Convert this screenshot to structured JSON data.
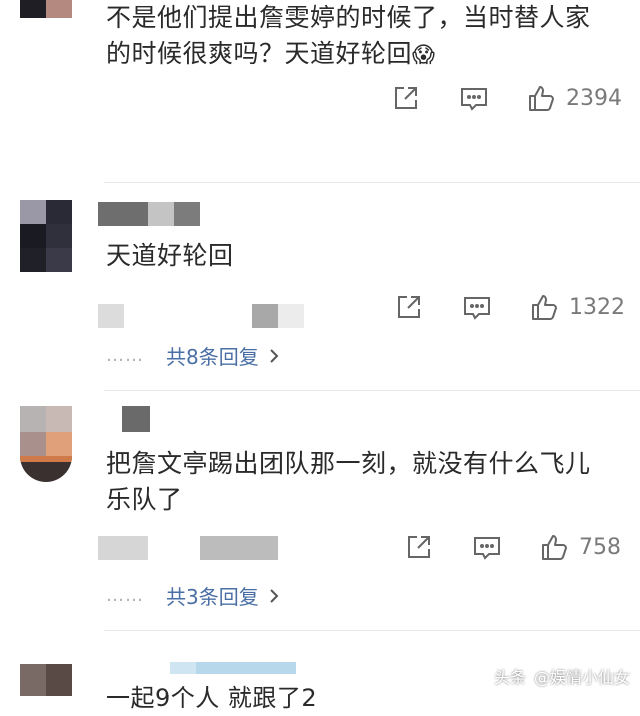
{
  "comments": [
    {
      "text_lines": [
        "不是他们提出詹雯婷的时候了，当时替人家",
        "的时候很爽吗？天道好轮回"
      ],
      "emoji": "😱",
      "likes": "2394"
    },
    {
      "text_lines": [
        "天道好轮回"
      ],
      "likes": "1322",
      "replies_label": "共8条回复"
    },
    {
      "text_lines": [
        "把詹文亭踢出团队那一刻，就没有什么飞儿",
        "乐队了"
      ],
      "likes": "758",
      "replies_label": "共3条回复"
    },
    {
      "partial_line": "一起9个人 就跟了2"
    }
  ],
  "icons": {
    "share": "share-icon",
    "comment": "comment-icon",
    "like": "thumbs-up-icon",
    "chevron": "chevron-right-icon"
  },
  "watermark": {
    "platform": "头条",
    "author": "@娱情小仙女"
  },
  "colors": {
    "text": "#2a2a2a",
    "meta": "#7a7a7a",
    "reply_link": "#4a6fa5",
    "divider": "#e6e6e6"
  }
}
